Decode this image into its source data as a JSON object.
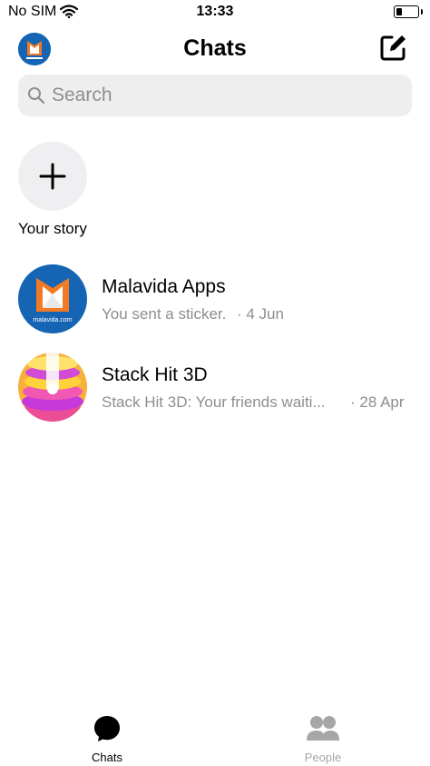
{
  "status_bar": {
    "carrier": "No SIM",
    "time": "13:33"
  },
  "header": {
    "title": "Chats"
  },
  "search": {
    "placeholder": "Search"
  },
  "story": {
    "label": "Your story"
  },
  "chats": [
    {
      "name": "Malavida Apps",
      "preview": "You sent a sticker.",
      "date": "· 4 Jun"
    },
    {
      "name": "Stack Hit 3D",
      "preview": "Stack Hit 3D: Your friends waiti...",
      "date": "· 28 Apr"
    }
  ],
  "avatar_brand_text": "malavida.com",
  "tabs": [
    {
      "label": "Chats",
      "active": true
    },
    {
      "label": "People",
      "active": false
    }
  ],
  "colors": {
    "accent": "#000000",
    "inactive": "#a6a6a6",
    "malavida_blue": "#1565b4",
    "search_bg": "#eeeeef"
  }
}
